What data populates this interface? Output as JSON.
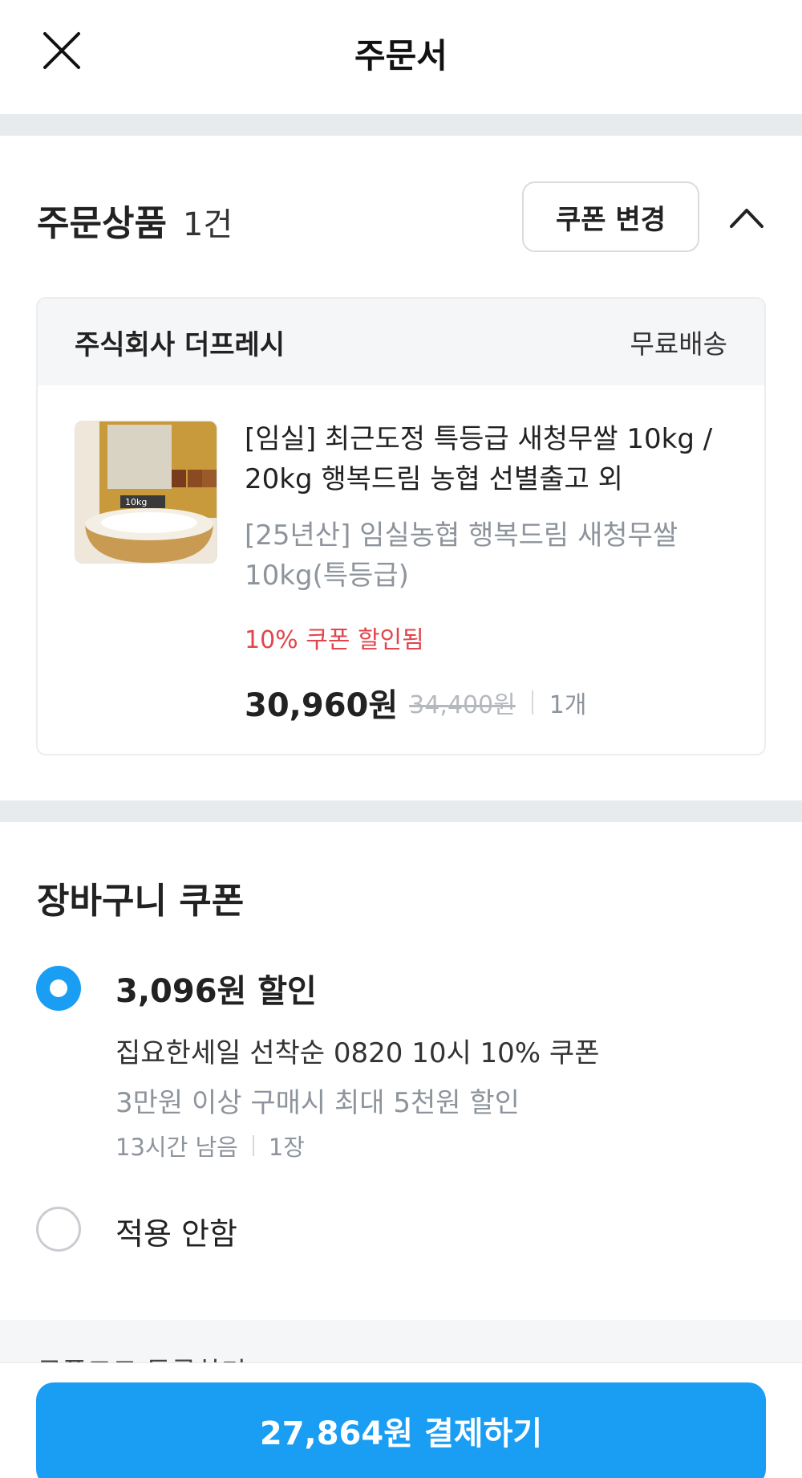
{
  "header": {
    "title": "주문서",
    "close_icon": "close-icon"
  },
  "order_section": {
    "title": "주문상품",
    "count": "1건",
    "coupon_change_label": "쿠폰 변경",
    "collapse_icon": "chevron-up-icon"
  },
  "store": {
    "name": "주식회사 더프레시",
    "shipping": "무료배송",
    "product": {
      "name": "[임실] 최근도정 특등급 새청무쌀 10kg / 20kg 행복드림 농협 선별출고 외",
      "option": "[25년산] 임실농협 행복드림 새청무쌀 10kg(특등급)",
      "discount_note": "10% 쿠폰 할인됨",
      "price": "30,960원",
      "original_price": "34,400원",
      "quantity": "1개",
      "thumb_label": "10kg"
    }
  },
  "cart_coupon": {
    "title": "장바구니 쿠폰",
    "options": [
      {
        "selected": true,
        "amount": "3,096원 할인",
        "name": "집요한세일 선착순 0820 10시 10% 쿠폰",
        "condition": "3만원 이상 구매시 최대 5천원 할인",
        "time_left": "13시간 남음",
        "count": "1장"
      },
      {
        "selected": false,
        "label": "적용 안함"
      }
    ],
    "code_label": "쿠폰코드 등록하기"
  },
  "payment": {
    "button_label": "27,864원 결제하기"
  },
  "colors": {
    "accent": "#1a9ef4",
    "discount": "#e0464c",
    "muted": "#8e949c",
    "divider": "#e8ebee"
  }
}
